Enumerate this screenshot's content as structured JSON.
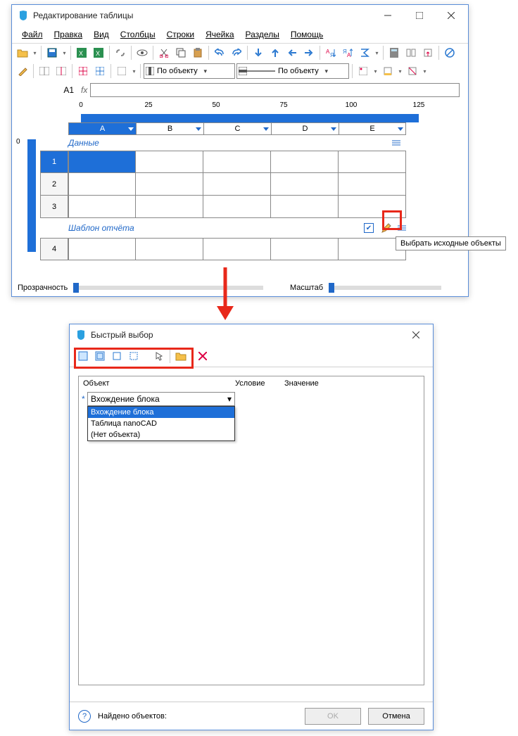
{
  "win1": {
    "title": "Редактирование таблицы",
    "menu": [
      "Файл",
      "Правка",
      "Вид",
      "Столбцы",
      "Строки",
      "Ячейка",
      "Разделы",
      "Помощь"
    ],
    "combo1_label": "По объекту",
    "combo2_label": "По объекту",
    "cellref": "A1",
    "cols": [
      "A",
      "B",
      "C",
      "D",
      "E"
    ],
    "row_nums": [
      "1",
      "2",
      "3",
      "4"
    ],
    "section_data": "Данные",
    "section_report": "Шаблон отчёта",
    "tooltip": "Выбрать исходные объекты",
    "transparency_label": "Прозрачность",
    "scale_label": "Масштаб",
    "ruler_major": [
      "0",
      "25",
      "50",
      "75",
      "100",
      "125"
    ]
  },
  "win2": {
    "title": "Быстрый выбор",
    "col_object": "Объект",
    "col_condition": "Условие",
    "col_value": "Значение",
    "combo_value": "Вхождение блока",
    "dropdown": [
      "Вхождение блока",
      "Таблица nanoCAD",
      "(Нет объекта)"
    ],
    "found_label": "Найдено объектов:",
    "ok": "OK",
    "cancel": "Отмена"
  }
}
